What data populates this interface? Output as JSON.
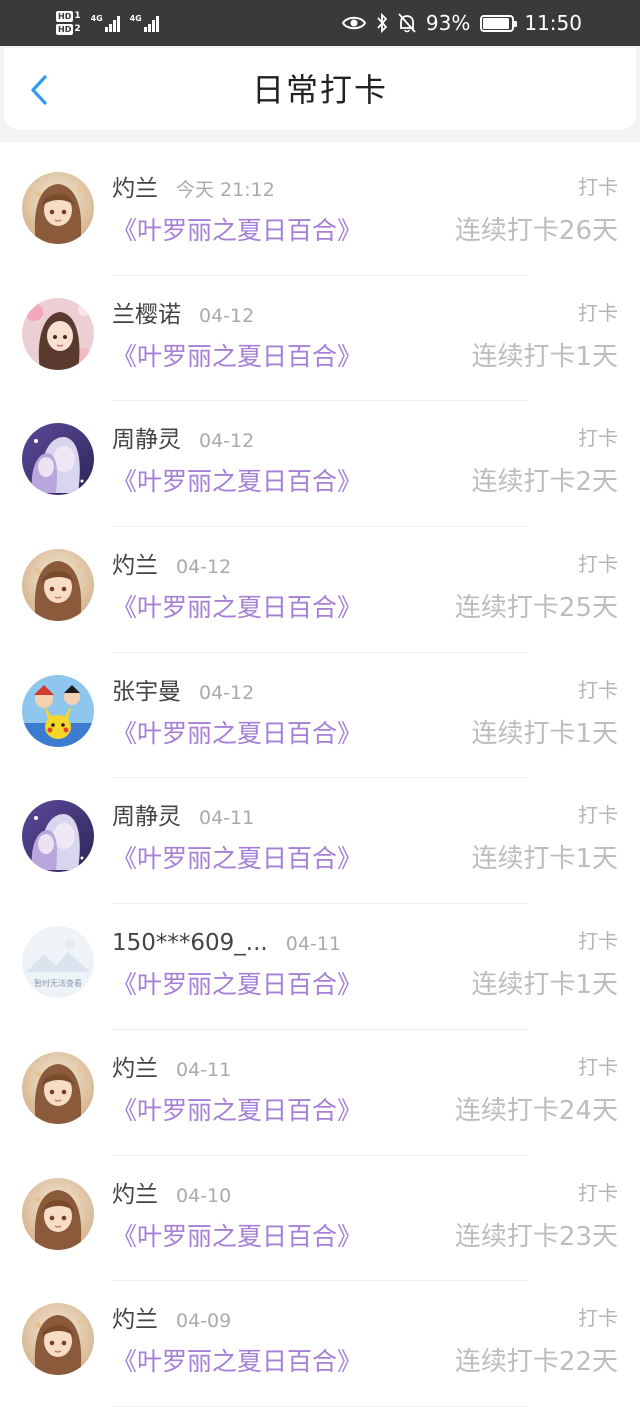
{
  "status_bar": {
    "hd1": "HD",
    "hd1_num": "1",
    "hd2": "HD",
    "hd2_num": "2",
    "net1": "4G",
    "net2": "4G",
    "battery_percent": "93%",
    "battery_level": 0.93,
    "time": "11:50",
    "icons": [
      "eye-icon",
      "bluetooth-icon",
      "mute-bell-icon",
      "battery-icon"
    ],
    "color": "#3a3a3a"
  },
  "nav": {
    "title": "日常打卡",
    "back_icon": "chevron-left-icon",
    "accent": "#2f9bf0"
  },
  "list": {
    "title_color": "#a67fd6",
    "items": [
      {
        "user": "灼兰",
        "time": "今天 21:12",
        "book": "《叶罗丽之夏日百合》",
        "action": "打卡",
        "streak": "连续打卡26天",
        "avatar": "avatar-girl-brown-hair"
      },
      {
        "user": "兰樱诺",
        "time": "04-12",
        "book": "《叶罗丽之夏日百合》",
        "action": "打卡",
        "streak": "连续打卡1天",
        "avatar": "avatar-girl-flowers"
      },
      {
        "user": "周静灵",
        "time": "04-12",
        "book": "《叶罗丽之夏日百合》",
        "action": "打卡",
        "streak": "连续打卡2天",
        "avatar": "avatar-anime-purple"
      },
      {
        "user": "灼兰",
        "time": "04-12",
        "book": "《叶罗丽之夏日百合》",
        "action": "打卡",
        "streak": "连续打卡25天",
        "avatar": "avatar-girl-brown-hair"
      },
      {
        "user": "张宇曼",
        "time": "04-12",
        "book": "《叶罗丽之夏日百合》",
        "action": "打卡",
        "streak": "连续打卡1天",
        "avatar": "avatar-pokemon"
      },
      {
        "user": "周静灵",
        "time": "04-11",
        "book": "《叶罗丽之夏日百合》",
        "action": "打卡",
        "streak": "连续打卡1天",
        "avatar": "avatar-anime-purple"
      },
      {
        "user": "150***609_...",
        "time": "04-11",
        "book": "《叶罗丽之夏日百合》",
        "action": "打卡",
        "streak": "连续打卡1天",
        "avatar": "avatar-placeholder",
        "avatar_text": "暂时无法查看"
      },
      {
        "user": "灼兰",
        "time": "04-11",
        "book": "《叶罗丽之夏日百合》",
        "action": "打卡",
        "streak": "连续打卡24天",
        "avatar": "avatar-girl-brown-hair"
      },
      {
        "user": "灼兰",
        "time": "04-10",
        "book": "《叶罗丽之夏日百合》",
        "action": "打卡",
        "streak": "连续打卡23天",
        "avatar": "avatar-girl-brown-hair"
      },
      {
        "user": "灼兰",
        "time": "04-09",
        "book": "《叶罗丽之夏日百合》",
        "action": "打卡",
        "streak": "连续打卡22天",
        "avatar": "avatar-girl-brown-hair"
      }
    ]
  }
}
